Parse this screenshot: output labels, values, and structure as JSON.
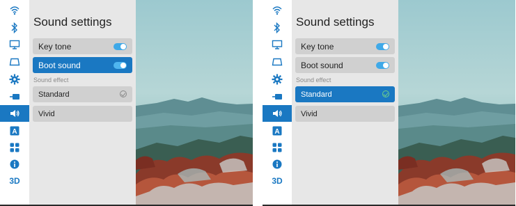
{
  "panels": [
    {
      "title": "Sound settings",
      "key_tone_label": "Key tone",
      "key_tone_on": true,
      "boot_sound_label": "Boot sound",
      "boot_sound_on": true,
      "sound_effect_label": "Sound effect",
      "effects": [
        "Standard",
        "Vivid"
      ],
      "selected_row": "boot_sound",
      "checked_effect": "Standard"
    },
    {
      "title": "Sound settings",
      "key_tone_label": "Key tone",
      "key_tone_on": true,
      "boot_sound_label": "Boot sound",
      "boot_sound_on": true,
      "sound_effect_label": "Sound effect",
      "effects": [
        "Standard",
        "Vivid"
      ],
      "selected_row": "standard",
      "checked_effect": "Standard"
    }
  ],
  "sidebar": {
    "icons": [
      "wifi-icon",
      "bluetooth-icon",
      "display-icon",
      "projection-icon",
      "gear-icon",
      "input-source-icon",
      "speaker-icon",
      "language-icon",
      "apps-icon",
      "info-icon",
      "3d-icon"
    ],
    "active": "speaker-icon",
    "label_3d": "3D"
  },
  "colors": {
    "accent": "#1a78c2",
    "toggle": "#3fa9e8",
    "menu_bg": "#e7e7e7",
    "row_bg": "#d0d0d0"
  }
}
